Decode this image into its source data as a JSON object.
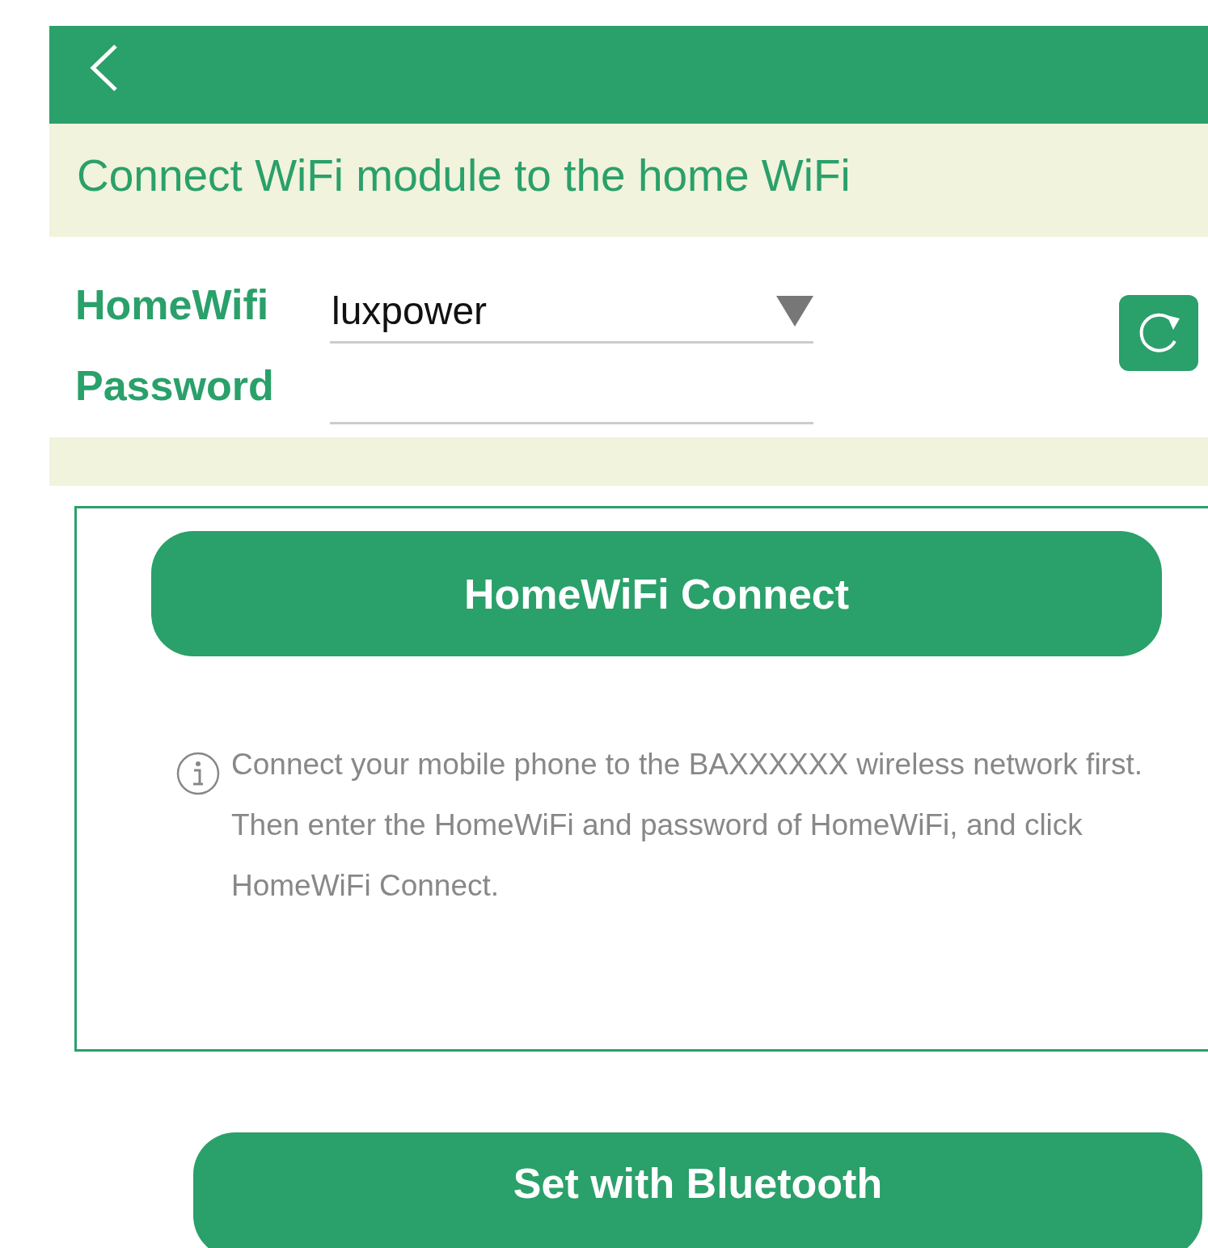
{
  "title": "Connect WiFi module to the home WiFi",
  "fields": [
    {
      "kind": "select",
      "label": "HomeWifi",
      "value": "luxpower"
    },
    {
      "kind": "password",
      "label": "Password"
    }
  ],
  "card": {
    "button": "HomeWiFi Connect",
    "info": "Connect your mobile phone to the BAXXXXXX wireless network first. Then enter the HomeWiFi and password of HomeWiFi, and click HomeWiFi Connect."
  },
  "bottom_button": "Set with Bluetooth"
}
